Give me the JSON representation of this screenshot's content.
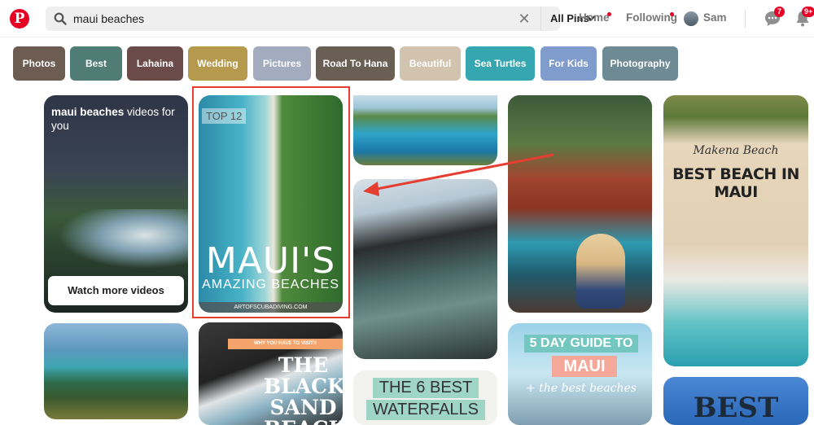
{
  "header": {
    "logo_letter": "P",
    "search_query": "maui beaches",
    "scope_label": "All Pins",
    "nav": {
      "home": "Home",
      "following": "Following",
      "user": "Sam"
    },
    "messages_badge": "7",
    "notifications_badge": "9+"
  },
  "guides": [
    {
      "label": "Photos",
      "color": "#6d5c51"
    },
    {
      "label": "Best",
      "color": "#4f7c75"
    },
    {
      "label": "Lahaina",
      "color": "#6b4a4a"
    },
    {
      "label": "Wedding",
      "color": "#b59a4d"
    },
    {
      "label": "Pictures",
      "color": "#a3abbf"
    },
    {
      "label": "Road To Hana",
      "color": "#6a5f55"
    },
    {
      "label": "Beautiful",
      "color": "#d1c3ae"
    },
    {
      "label": "Sea Turtles",
      "color": "#36a7b1"
    },
    {
      "label": "For Kids",
      "color": "#7f9ccc"
    },
    {
      "label": "Photography",
      "color": "#6e8a94"
    }
  ],
  "video_card": {
    "title_bold": "maui beaches",
    "title_rest": " videos for you",
    "button_label": "Watch more videos"
  },
  "pins": {
    "amazing": {
      "tag": "TOP 12",
      "title": "MAUI'S",
      "subtitle": "AMAZING BEACHES",
      "credit": "ARTOFSCUBADIVING.COM"
    },
    "makena": {
      "kicker": "Makena Beach",
      "title": "BEST BEACH IN MAUI"
    },
    "black_sand": {
      "kicker": "WHY YOU HAVE TO VISIT!!",
      "title_lines": [
        "THE",
        "BLACK",
        "SAND",
        "BEACH"
      ]
    },
    "waterfalls": {
      "line1": "THE 6 BEST",
      "line2": "WATERFALLS"
    },
    "guide": {
      "line1": "5 DAY GUIDE TO",
      "line2": "MAUI",
      "line3": "+ the best beaches"
    },
    "best": {
      "title": "BEST"
    }
  }
}
